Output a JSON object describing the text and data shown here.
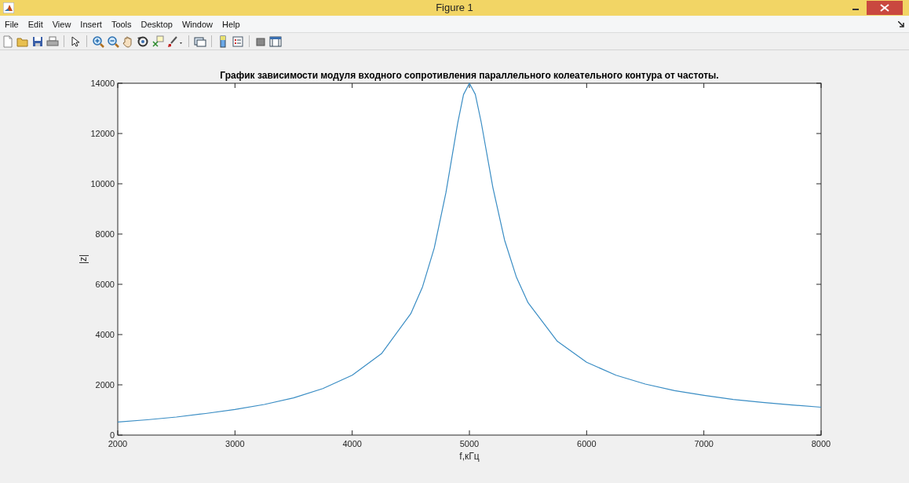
{
  "window": {
    "title": "Figure 1"
  },
  "menu": [
    "File",
    "Edit",
    "View",
    "Insert",
    "Tools",
    "Desktop",
    "Window",
    "Help"
  ],
  "chart_data": {
    "type": "line",
    "title": "График зависимости модуля входного сопротивления параллельного колеательного контура от частоты.",
    "xlabel": "f,кГц",
    "ylabel": "|z|",
    "xlim": [
      2000,
      8000
    ],
    "ylim": [
      0,
      14000
    ],
    "xticks": [
      2000,
      3000,
      4000,
      5000,
      6000,
      7000,
      8000
    ],
    "yticks": [
      0,
      2000,
      4000,
      6000,
      8000,
      10000,
      12000,
      14000
    ],
    "x": [
      2000,
      2250,
      2500,
      2750,
      3000,
      3250,
      3500,
      3750,
      4000,
      4250,
      4500,
      4600,
      4700,
      4800,
      4900,
      4950,
      5000,
      5050,
      5100,
      5200,
      5300,
      5400,
      5500,
      5750,
      6000,
      6250,
      6500,
      6750,
      7000,
      7250,
      7500,
      7750,
      8000
    ],
    "series": [
      {
        "color": "#3a8dc4",
        "values": [
          520,
          610,
          720,
          860,
          1020,
          1220,
          1480,
          1850,
          2380,
          3240,
          4830,
          5900,
          7440,
          9650,
          12420,
          13550,
          14000,
          13560,
          12470,
          9850,
          7760,
          6300,
          5270,
          3730,
          2900,
          2380,
          2030,
          1770,
          1580,
          1420,
          1300,
          1200,
          1110
        ]
      }
    ]
  }
}
